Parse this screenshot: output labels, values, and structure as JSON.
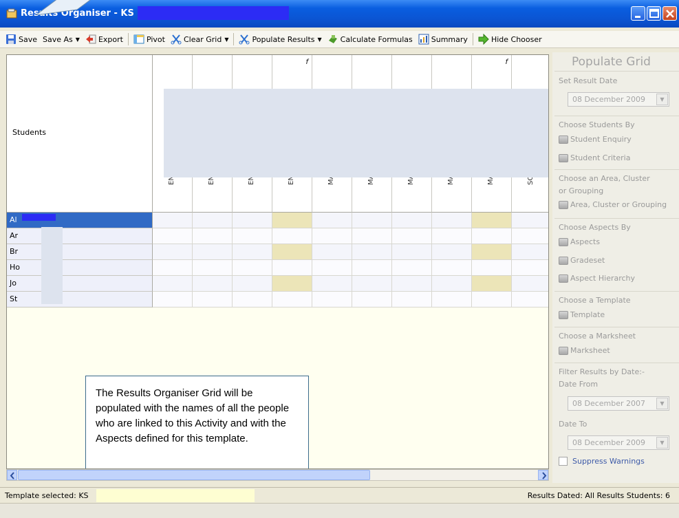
{
  "window": {
    "title": "Results Organiser - KS"
  },
  "toolbar": {
    "save": "Save",
    "save_as": "Save As",
    "export": "Export",
    "pivot": "Pivot",
    "clear_grid": "Clear Grid",
    "populate_results": "Populate Results",
    "calculate_formulas": "Calculate Formulas",
    "summary": "Summary",
    "hide_chooser": "Hide Chooser"
  },
  "grid": {
    "students_header": "Students",
    "columns": [
      {
        "abbr": "EN",
        "formula": ""
      },
      {
        "abbr": "EN",
        "formula": ""
      },
      {
        "abbr": "EN",
        "formula": ""
      },
      {
        "abbr": "EN",
        "formula": "f"
      },
      {
        "abbr": "MA",
        "formula": ""
      },
      {
        "abbr": "MA",
        "formula": ""
      },
      {
        "abbr": "MA",
        "formula": ""
      },
      {
        "abbr": "MA",
        "formula": ""
      },
      {
        "abbr": "MA",
        "formula": "f"
      },
      {
        "abbr": "SC",
        "formula": ""
      }
    ],
    "rows": [
      "Al",
      "Ar",
      "Br",
      "Ho",
      "Jo",
      "St"
    ]
  },
  "note": "The Results Organiser Grid will be populated with the names of all the people who are linked to this Activity and with the Aspects defined for this template.",
  "panel": {
    "title": "Populate Grid",
    "set_result_date": "Set Result Date",
    "result_date": "08 December 2009",
    "choose_students_by": "Choose Students By",
    "student_enquiry": "Student Enquiry",
    "student_criteria": "Student Criteria",
    "choose_area_1": "Choose an Area, Cluster",
    "choose_area_2": "or Grouping",
    "area_button": "Area, Cluster or Grouping",
    "choose_aspects_by": "Choose Aspects By",
    "aspects": "Aspects",
    "gradeset": "Gradeset",
    "aspect_hierarchy": "Aspect Hierarchy",
    "choose_template": "Choose a Template",
    "template": "Template",
    "choose_marksheet": "Choose a Marksheet",
    "marksheet": "Marksheet",
    "filter_1": "Filter Results by Date:-",
    "date_from": "Date From",
    "date_from_value": "08 December 2007",
    "date_to": "Date To",
    "date_to_value": "08 December 2009",
    "suppress_warnings": "Suppress Warnings"
  },
  "status": {
    "template_selected": "Template selected: KS",
    "results_dated": "Results Dated: All Results  Students: 6"
  },
  "colors": {
    "titlebar": "#0a5ee0",
    "selection": "#316ac5",
    "highlight_column": "#ece5b8",
    "grid_background": "#fffff0"
  }
}
